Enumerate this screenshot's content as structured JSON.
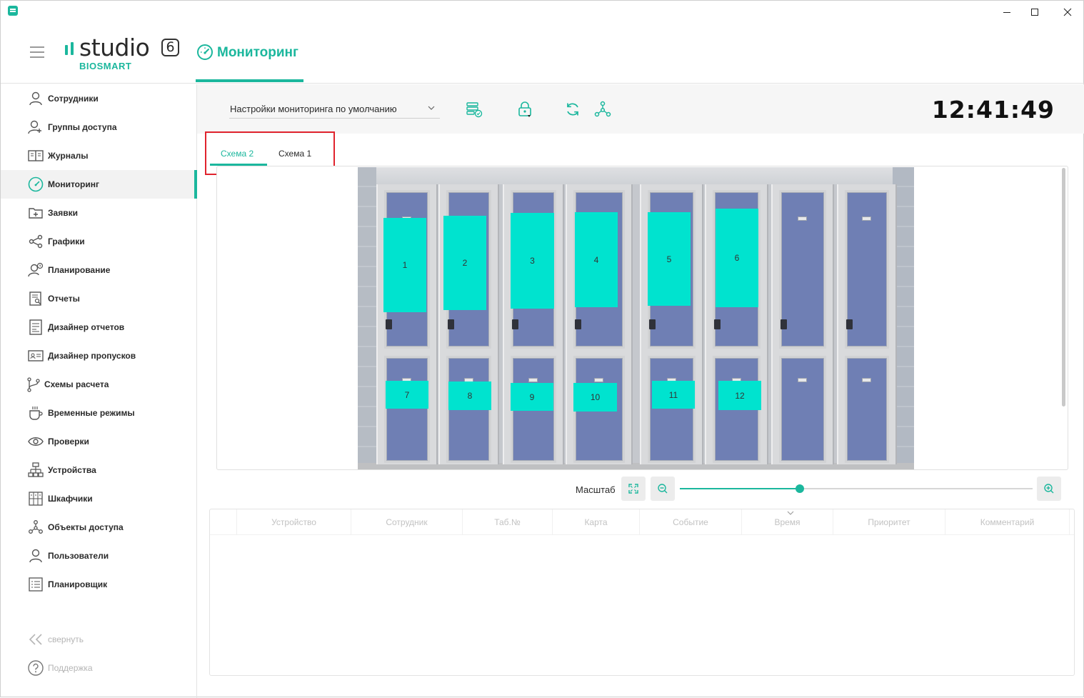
{
  "app": {
    "logo_word": "studio",
    "logo_version": "6",
    "logo_sub": "BIOSMART",
    "page_title": "Мониторинг",
    "window_controls": [
      "minimize",
      "maximize",
      "close"
    ]
  },
  "sidebar": {
    "items": [
      {
        "label": "Сотрудники",
        "icon": "user-icon",
        "active": false
      },
      {
        "label": "Группы доступа",
        "icon": "user-group-icon",
        "active": false
      },
      {
        "label": "Журналы",
        "icon": "book-icon",
        "active": false
      },
      {
        "label": "Мониторинг",
        "icon": "gauge-icon",
        "active": true
      },
      {
        "label": "Заявки",
        "icon": "folder-plus-icon",
        "active": false
      },
      {
        "label": "Графики",
        "icon": "share-nodes-icon",
        "active": false
      },
      {
        "label": "Планирование",
        "icon": "user-clock-icon",
        "active": false
      },
      {
        "label": "Отчеты",
        "icon": "report-search-icon",
        "active": false
      },
      {
        "label": "Дизайнер отчетов",
        "icon": "report-designer-icon",
        "active": false
      },
      {
        "label": "Дизайнер пропусков",
        "icon": "id-card-icon",
        "active": false
      },
      {
        "label": "Схемы расчета",
        "icon": "branch-icon",
        "active": false
      },
      {
        "label": "Временные режимы",
        "icon": "cup-icon",
        "active": false
      },
      {
        "label": "Проверки",
        "icon": "eye-icon",
        "active": false
      },
      {
        "label": "Устройства",
        "icon": "network-icon",
        "active": false
      },
      {
        "label": "Шкафчики",
        "icon": "lockers-icon",
        "active": false
      },
      {
        "label": "Объекты доступа",
        "icon": "access-objects-icon",
        "active": false
      },
      {
        "label": "Пользователи",
        "icon": "user-icon",
        "active": false
      },
      {
        "label": "Планировщик",
        "icon": "list-icon",
        "active": false
      }
    ],
    "collapse_label": "свернуть",
    "support_label": "Поддержка"
  },
  "toolbar": {
    "settings_select": "Настройки мониторинга по умолчанию",
    "buttons": [
      "settings-check-icon",
      "lock-download-icon",
      "refresh-icon",
      "hierarchy-icon"
    ],
    "clock": "12:41:49"
  },
  "schemes": {
    "tabs": [
      {
        "label": "Схема 2",
        "active": true
      },
      {
        "label": "Схема 1",
        "active": false
      }
    ]
  },
  "lockers": {
    "marks": [
      "1",
      "2",
      "3",
      "4",
      "5",
      "6",
      "7",
      "8",
      "9",
      "10",
      "11",
      "12"
    ]
  },
  "scale": {
    "label": "Масштаб",
    "value": 0.34
  },
  "events_table": {
    "columns": [
      "",
      "Устройство",
      "Сотрудник",
      "Таб.№",
      "Карта",
      "Событие",
      "Время",
      "Приоритет",
      "Комментарий"
    ],
    "sorted_column": "Время",
    "rows": []
  },
  "colors": {
    "accent": "#1bb79d",
    "mark": "#00e3cf",
    "highlight_border": "#e0232d",
    "locker_door": "#6f7fb4"
  }
}
